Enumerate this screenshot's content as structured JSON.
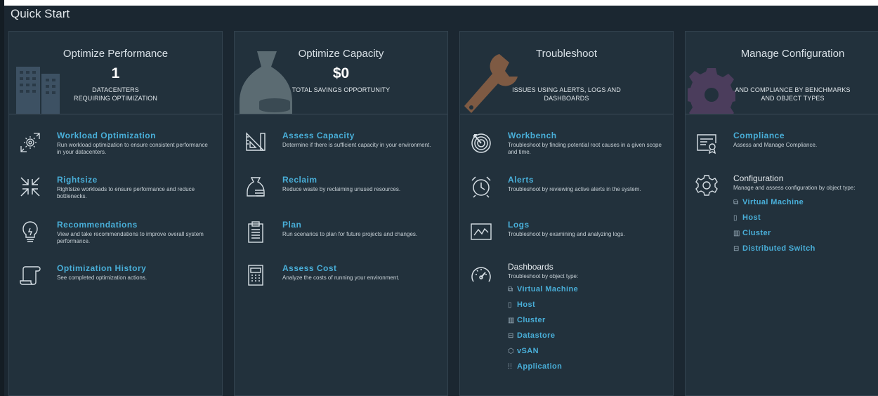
{
  "page": {
    "title": "Quick Start"
  },
  "colors": {
    "background": "#1b2731",
    "card": "#22313c",
    "link": "#49afd9"
  },
  "cards": [
    {
      "title": "Optimize Performance",
      "value": "1",
      "sub_lines": [
        "DATACENTERS",
        "REQUIRING OPTIMIZATION"
      ],
      "items": [
        {
          "icon": "workload-optimization-icon",
          "title": "Workload Optimization",
          "desc": "Run workload optimization to ensure consistent performance in your datacenters."
        },
        {
          "icon": "rightsize-icon",
          "title": "Rightsize",
          "desc": "Rightsize workloads to ensure performance and reduce bottlenecks."
        },
        {
          "icon": "lightbulb-icon",
          "title": "Recommendations",
          "desc": "View and take recommendations to improve overall system performance."
        },
        {
          "icon": "scroll-icon",
          "title": "Optimization History",
          "desc": "See completed optimization actions."
        }
      ]
    },
    {
      "title": "Optimize Capacity",
      "value": "$0",
      "sub_lines": [
        "TOTAL SAVINGS OPPORTUNITY"
      ],
      "items": [
        {
          "icon": "ruler-triangle-icon",
          "title": "Assess Capacity",
          "desc": "Determine if there is sufficient capacity in your environment."
        },
        {
          "icon": "money-bag-icon",
          "title": "Reclaim",
          "desc": "Reduce waste by reclaiming unused resources."
        },
        {
          "icon": "clipboard-icon",
          "title": "Plan",
          "desc": "Run scenarios to plan for future projects and changes."
        },
        {
          "icon": "calculator-icon",
          "title": "Assess Cost",
          "desc": "Analyze the costs of running your environment."
        }
      ]
    },
    {
      "title": "Troubleshoot",
      "sub_lines": [
        "ISSUES USING ALERTS, LOGS AND",
        "DASHBOARDS"
      ],
      "items": [
        {
          "icon": "target-icon",
          "title": "Workbench",
          "desc": "Troubleshoot by finding potential root causes in a given scope and time."
        },
        {
          "icon": "alarm-clock-icon",
          "title": "Alerts",
          "desc": "Troubleshoot by reviewing active alerts in the system."
        },
        {
          "icon": "logs-graph-icon",
          "title": "Logs",
          "desc": "Troubleshoot by examining and analyzing logs."
        },
        {
          "icon": "dashboard-gauge-icon",
          "title": "Dashboards",
          "desc": "Troubleshoot by object type:",
          "links": [
            "Virtual Machine",
            "Host",
            "Cluster",
            "Datastore",
            "vSAN",
            "Application"
          ]
        }
      ]
    },
    {
      "title": "Manage Configuration",
      "sub_lines": [
        "AND COMPLIANCE BY BENCHMARKS",
        "AND OBJECT TYPES"
      ],
      "items": [
        {
          "icon": "certificate-icon",
          "title": "Compliance",
          "desc": "Assess and Manage Compliance."
        },
        {
          "icon": "gear-icon",
          "title": "Configuration",
          "desc": "Manage and assess configuration by object type:",
          "links": [
            "Virtual Machine",
            "Host",
            "Cluster",
            "Distributed Switch"
          ]
        }
      ]
    }
  ]
}
